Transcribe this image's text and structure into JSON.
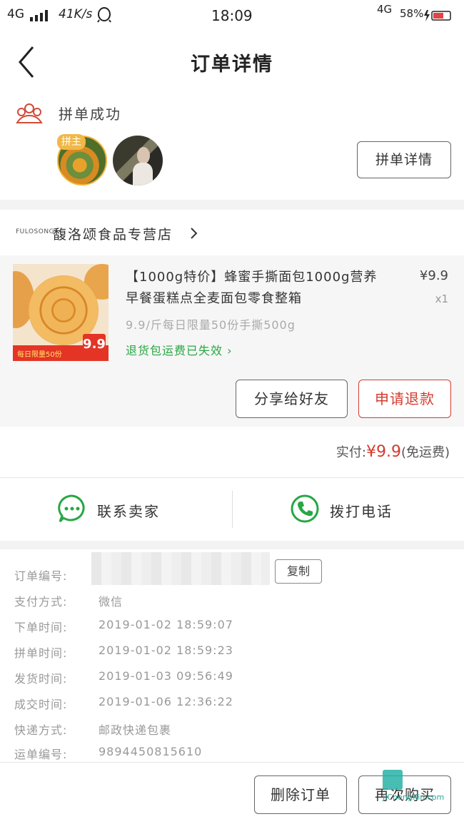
{
  "status_bar": {
    "network": "4G",
    "speed": "41K/s",
    "time": "18:09",
    "network_right": "4G",
    "battery": "58%"
  },
  "header": {
    "title": "订单详情"
  },
  "group": {
    "status": "拼单成功",
    "host_badge": "拼主",
    "detail_button": "拼单详情"
  },
  "shop": {
    "logo_text": "FULOSONG",
    "name": "馥洛颂食品专营店"
  },
  "product": {
    "title": "【1000g特价】蜂蜜手撕面包1000g营养早餐蛋糕点全麦面包零食整箱",
    "price": "¥9.9",
    "quantity": "x1",
    "spec": "9.9/斤每日限量50份手撕500g",
    "shipping_note": "退货包运费已失效",
    "image_tag": "每日限量50份",
    "image_price": "9.9"
  },
  "actions": {
    "share": "分享给好友",
    "refund": "申请退款"
  },
  "payment": {
    "label": "实付:",
    "amount": "¥9.9",
    "note": "(免运费)"
  },
  "contact": {
    "seller": "联系卖家",
    "phone": "拨打电话"
  },
  "order_info": {
    "copy_button": "复制",
    "rows": [
      {
        "label": "订单编号:",
        "value": ""
      },
      {
        "label": "支付方式:",
        "value": "微信"
      },
      {
        "label": "下单时间:",
        "value": "2019-01-02 18:59:07"
      },
      {
        "label": "拼单时间:",
        "value": "2019-01-02 18:59:23"
      },
      {
        "label": "发货时间:",
        "value": "2019-01-03 09:56:49"
      },
      {
        "label": "成交时间:",
        "value": "2019-01-06 12:36:22"
      },
      {
        "label": "快递方式:",
        "value": "邮政快递包裹"
      },
      {
        "label": "运单编号:",
        "value": "9894450815610"
      }
    ]
  },
  "bottom": {
    "delete": "删除订单",
    "rebuy": "再次购买",
    "watermark": "JiChengXin.com"
  },
  "colors": {
    "accent_red": "#d43b2e",
    "wechat_green": "#28a745"
  }
}
